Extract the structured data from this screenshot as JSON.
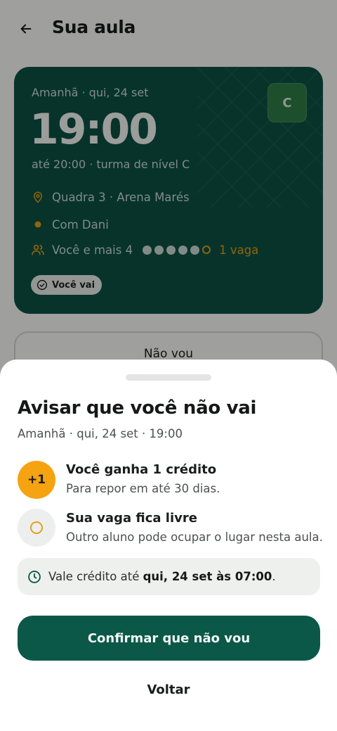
{
  "header": {
    "title": "Sua aula",
    "back_icon": "arrow-left-icon"
  },
  "class_card": {
    "date": "Amanhã · qui, 24 set",
    "time": "19:00",
    "until": "até 20:00 · turma de nível C",
    "level_badge": "C",
    "location": "Quadra 3 · Arena Marés",
    "instructor": "Com Dani",
    "participants": "Você e mais 4",
    "seats_filled": 5,
    "seats_total": 6,
    "seats_left_label": "1 vaga",
    "status_pill": "Você vai",
    "colors": {
      "card_bg": "#0b4f43",
      "accent": "#e09a12"
    }
  },
  "behind_button": {
    "label": "Não vou"
  },
  "sheet": {
    "title": "Avisar que você não vai",
    "subtitle": "Amanhã · qui, 24 set · 19:00",
    "benefits": [
      {
        "badge": "+1",
        "title": "Você ganha 1 crédito",
        "description": "Para repor em até 30 dias."
      },
      {
        "badge": "",
        "title": "Sua vaga fica livre",
        "description": "Outro aluno pode ocupar o lugar nesta aula."
      }
    ],
    "validity_prefix": "Vale crédito até ",
    "validity_bold": "qui, 24 set às 07:00",
    "validity_suffix": ".",
    "confirm_label": "Confirmar que não vou",
    "back_label": "Voltar",
    "colors": {
      "primary": "#0b5848",
      "credit": "#f5a310"
    }
  }
}
